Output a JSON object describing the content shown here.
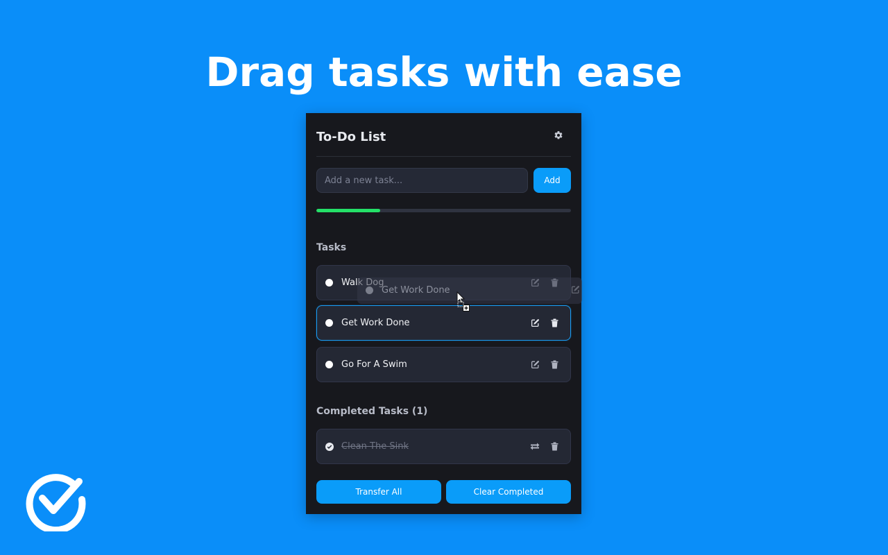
{
  "page": {
    "headline": "Drag tasks with ease"
  },
  "colors": {
    "background": "#0a8ef9",
    "panel": "#17181d",
    "accent": "#0a9cf9",
    "progress": "#24e068"
  },
  "app": {
    "title": "To-Do List",
    "settings_icon": "gear-icon",
    "input_placeholder": "Add a new task...",
    "input_value": "",
    "add_label": "Add",
    "progress_fraction": 0.25
  },
  "tasks_section": {
    "title": "Tasks",
    "items": [
      {
        "label": "Walk Dog",
        "selected": false
      },
      {
        "label": "Get Work Done",
        "selected": true
      },
      {
        "label": "Go For A Swim",
        "selected": false
      }
    ]
  },
  "drag_preview": {
    "label": "Get Work Done"
  },
  "completed_section": {
    "title": "Completed Tasks (1)",
    "items": [
      {
        "label": "Clean The Sink"
      }
    ]
  },
  "footer": {
    "transfer_label": "Transfer All",
    "clear_label": "Clear Completed"
  }
}
